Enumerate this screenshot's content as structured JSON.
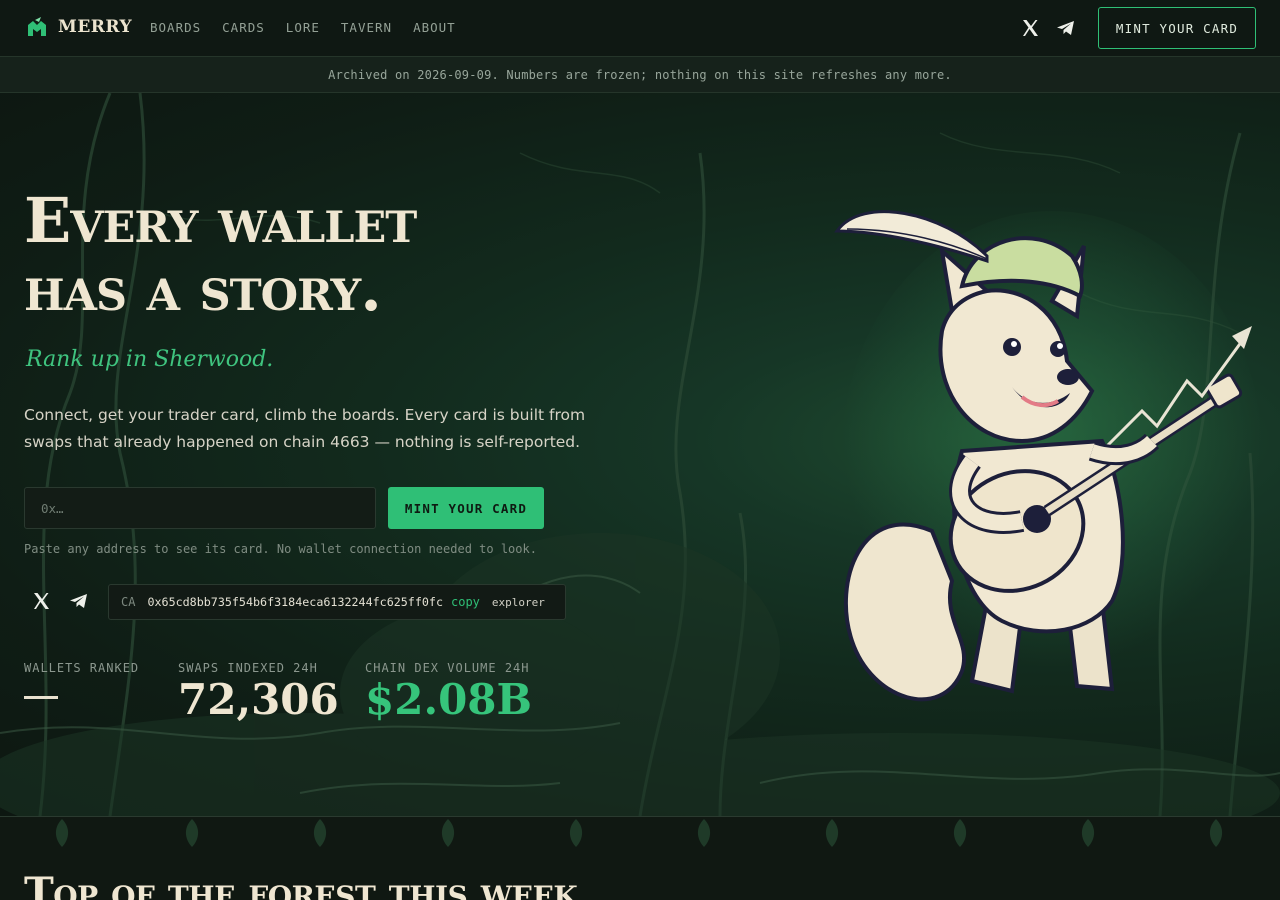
{
  "nav": {
    "brand": "MERRY",
    "links": [
      "BOARDS",
      "CARDS",
      "LORE",
      "TAVERN",
      "ABOUT"
    ],
    "mint_label": "MINT YOUR CARD"
  },
  "banner": {
    "text": "Archived on 2026-09-09. Numbers are frozen; nothing on this site refreshes any more."
  },
  "hero": {
    "title_line1": "Every wallet",
    "title_line2": "has a story.",
    "tagline": "Rank up in Sherwood.",
    "description": "Connect, get your trader card, climb the boards. Every card is built from swaps that already happened on chain 4663 — nothing is self-reported.",
    "input_placeholder": "0x…",
    "mint_label": "MINT YOUR CARD",
    "hint": "Paste any address to see its card. No wallet connection needed to look.",
    "ca": {
      "label": "CA",
      "address": "0x65cd8bb735f54b6f3184eca6132244fc625ff0fc",
      "copy": "copy",
      "explorer": "explorer"
    }
  },
  "stats": [
    {
      "label": "WALLETS RANKED",
      "value": ""
    },
    {
      "label": "SWAPS INDEXED 24H",
      "value": "72,306"
    },
    {
      "label": "CHAIN DEX VOLUME 24H",
      "value": "$2.08B"
    }
  ],
  "section": {
    "title": "Top of the forest this week"
  },
  "colors": {
    "accent": "#2fbf76",
    "background": "#0f1712",
    "text": "#efe6d1"
  },
  "icons": [
    "merry-logo-icon",
    "x-icon",
    "telegram-icon",
    "fox-bard-mascot"
  ]
}
